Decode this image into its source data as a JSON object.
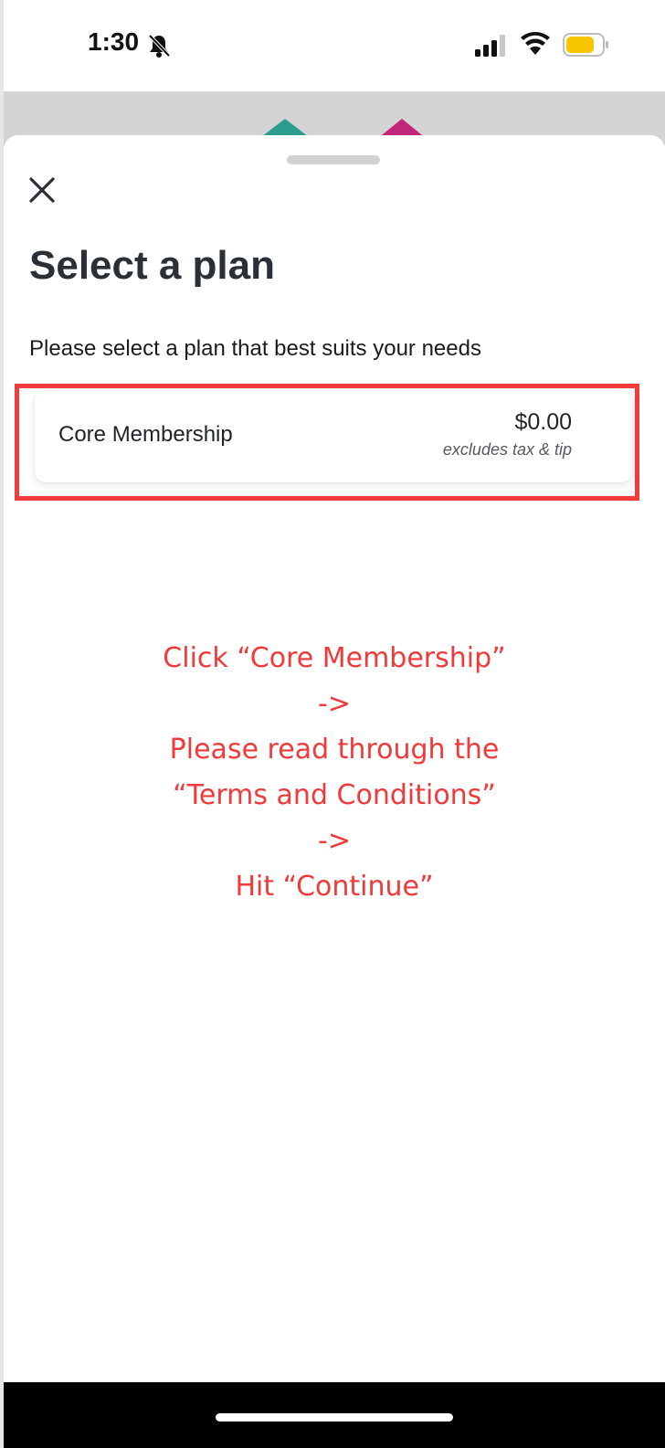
{
  "status_bar": {
    "time": "1:30",
    "icons": [
      "bell-slash-icon",
      "signal-icon",
      "wifi-icon",
      "battery-icon"
    ],
    "battery_color": "#f7c600"
  },
  "backdrop": {
    "shape_colors": [
      "#2a9d8f",
      "#c0267a"
    ]
  },
  "sheet": {
    "close_icon": "close-icon",
    "title": "Select a plan",
    "subtitle": "Please select a plan that best suits your needs",
    "plans": [
      {
        "name": "Core Membership",
        "price": "$0.00",
        "note": "excludes tax & tip"
      }
    ]
  },
  "annotation": {
    "color": "#f03a3a",
    "lines": [
      "Click “Core Membership”",
      "->",
      "Please read through the",
      "“Terms and Conditions”",
      "->",
      "Hit “Continue”"
    ]
  }
}
